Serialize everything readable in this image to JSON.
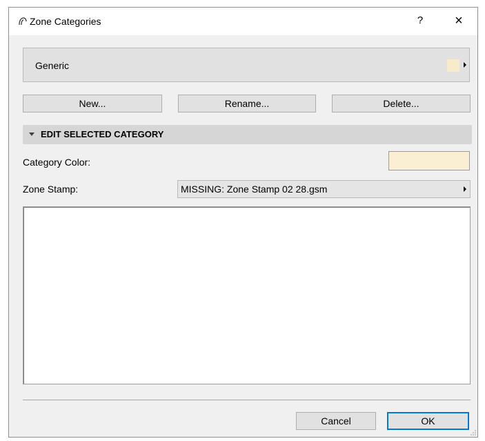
{
  "window": {
    "title": "Zone Categories",
    "help_label": "?",
    "close_label": "×",
    "app_icon": "archicad-icon"
  },
  "category": {
    "selected": "Generic",
    "color": "#f8ebc9"
  },
  "buttons": {
    "new": "New...",
    "rename": "Rename...",
    "delete": "Delete..."
  },
  "section": {
    "title": "EDIT SELECTED CATEGORY"
  },
  "fields": {
    "category_color_label": "Category Color:",
    "category_color_value": "#fbefd3",
    "zone_stamp_label": "Zone Stamp:",
    "zone_stamp_value": "MISSING: Zone Stamp 02 28.gsm"
  },
  "footer": {
    "cancel": "Cancel",
    "ok": "OK"
  },
  "colors": {
    "accent": "#0078d7",
    "dialog_bg": "#f0f0f0"
  }
}
